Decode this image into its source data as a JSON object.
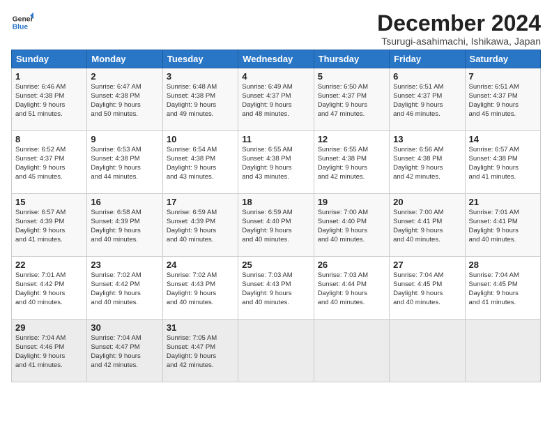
{
  "logo": {
    "line1": "General",
    "line2": "Blue"
  },
  "title": "December 2024",
  "location": "Tsurugi-asahimachi, Ishikawa, Japan",
  "days_of_week": [
    "Sunday",
    "Monday",
    "Tuesday",
    "Wednesday",
    "Thursday",
    "Friday",
    "Saturday"
  ],
  "weeks": [
    [
      {
        "day": 1,
        "info": "Sunrise: 6:46 AM\nSunset: 4:38 PM\nDaylight: 9 hours\nand 51 minutes."
      },
      {
        "day": 2,
        "info": "Sunrise: 6:47 AM\nSunset: 4:38 PM\nDaylight: 9 hours\nand 50 minutes."
      },
      {
        "day": 3,
        "info": "Sunrise: 6:48 AM\nSunset: 4:38 PM\nDaylight: 9 hours\nand 49 minutes."
      },
      {
        "day": 4,
        "info": "Sunrise: 6:49 AM\nSunset: 4:37 PM\nDaylight: 9 hours\nand 48 minutes."
      },
      {
        "day": 5,
        "info": "Sunrise: 6:50 AM\nSunset: 4:37 PM\nDaylight: 9 hours\nand 47 minutes."
      },
      {
        "day": 6,
        "info": "Sunrise: 6:51 AM\nSunset: 4:37 PM\nDaylight: 9 hours\nand 46 minutes."
      },
      {
        "day": 7,
        "info": "Sunrise: 6:51 AM\nSunset: 4:37 PM\nDaylight: 9 hours\nand 45 minutes."
      }
    ],
    [
      {
        "day": 8,
        "info": "Sunrise: 6:52 AM\nSunset: 4:37 PM\nDaylight: 9 hours\nand 45 minutes."
      },
      {
        "day": 9,
        "info": "Sunrise: 6:53 AM\nSunset: 4:38 PM\nDaylight: 9 hours\nand 44 minutes."
      },
      {
        "day": 10,
        "info": "Sunrise: 6:54 AM\nSunset: 4:38 PM\nDaylight: 9 hours\nand 43 minutes."
      },
      {
        "day": 11,
        "info": "Sunrise: 6:55 AM\nSunset: 4:38 PM\nDaylight: 9 hours\nand 43 minutes."
      },
      {
        "day": 12,
        "info": "Sunrise: 6:55 AM\nSunset: 4:38 PM\nDaylight: 9 hours\nand 42 minutes."
      },
      {
        "day": 13,
        "info": "Sunrise: 6:56 AM\nSunset: 4:38 PM\nDaylight: 9 hours\nand 42 minutes."
      },
      {
        "day": 14,
        "info": "Sunrise: 6:57 AM\nSunset: 4:38 PM\nDaylight: 9 hours\nand 41 minutes."
      }
    ],
    [
      {
        "day": 15,
        "info": "Sunrise: 6:57 AM\nSunset: 4:39 PM\nDaylight: 9 hours\nand 41 minutes."
      },
      {
        "day": 16,
        "info": "Sunrise: 6:58 AM\nSunset: 4:39 PM\nDaylight: 9 hours\nand 40 minutes."
      },
      {
        "day": 17,
        "info": "Sunrise: 6:59 AM\nSunset: 4:39 PM\nDaylight: 9 hours\nand 40 minutes."
      },
      {
        "day": 18,
        "info": "Sunrise: 6:59 AM\nSunset: 4:40 PM\nDaylight: 9 hours\nand 40 minutes."
      },
      {
        "day": 19,
        "info": "Sunrise: 7:00 AM\nSunset: 4:40 PM\nDaylight: 9 hours\nand 40 minutes."
      },
      {
        "day": 20,
        "info": "Sunrise: 7:00 AM\nSunset: 4:41 PM\nDaylight: 9 hours\nand 40 minutes."
      },
      {
        "day": 21,
        "info": "Sunrise: 7:01 AM\nSunset: 4:41 PM\nDaylight: 9 hours\nand 40 minutes."
      }
    ],
    [
      {
        "day": 22,
        "info": "Sunrise: 7:01 AM\nSunset: 4:42 PM\nDaylight: 9 hours\nand 40 minutes."
      },
      {
        "day": 23,
        "info": "Sunrise: 7:02 AM\nSunset: 4:42 PM\nDaylight: 9 hours\nand 40 minutes."
      },
      {
        "day": 24,
        "info": "Sunrise: 7:02 AM\nSunset: 4:43 PM\nDaylight: 9 hours\nand 40 minutes."
      },
      {
        "day": 25,
        "info": "Sunrise: 7:03 AM\nSunset: 4:43 PM\nDaylight: 9 hours\nand 40 minutes."
      },
      {
        "day": 26,
        "info": "Sunrise: 7:03 AM\nSunset: 4:44 PM\nDaylight: 9 hours\nand 40 minutes."
      },
      {
        "day": 27,
        "info": "Sunrise: 7:04 AM\nSunset: 4:45 PM\nDaylight: 9 hours\nand 40 minutes."
      },
      {
        "day": 28,
        "info": "Sunrise: 7:04 AM\nSunset: 4:45 PM\nDaylight: 9 hours\nand 41 minutes."
      }
    ],
    [
      {
        "day": 29,
        "info": "Sunrise: 7:04 AM\nSunset: 4:46 PM\nDaylight: 9 hours\nand 41 minutes."
      },
      {
        "day": 30,
        "info": "Sunrise: 7:04 AM\nSunset: 4:47 PM\nDaylight: 9 hours\nand 42 minutes."
      },
      {
        "day": 31,
        "info": "Sunrise: 7:05 AM\nSunset: 4:47 PM\nDaylight: 9 hours\nand 42 minutes."
      },
      null,
      null,
      null,
      null
    ]
  ]
}
